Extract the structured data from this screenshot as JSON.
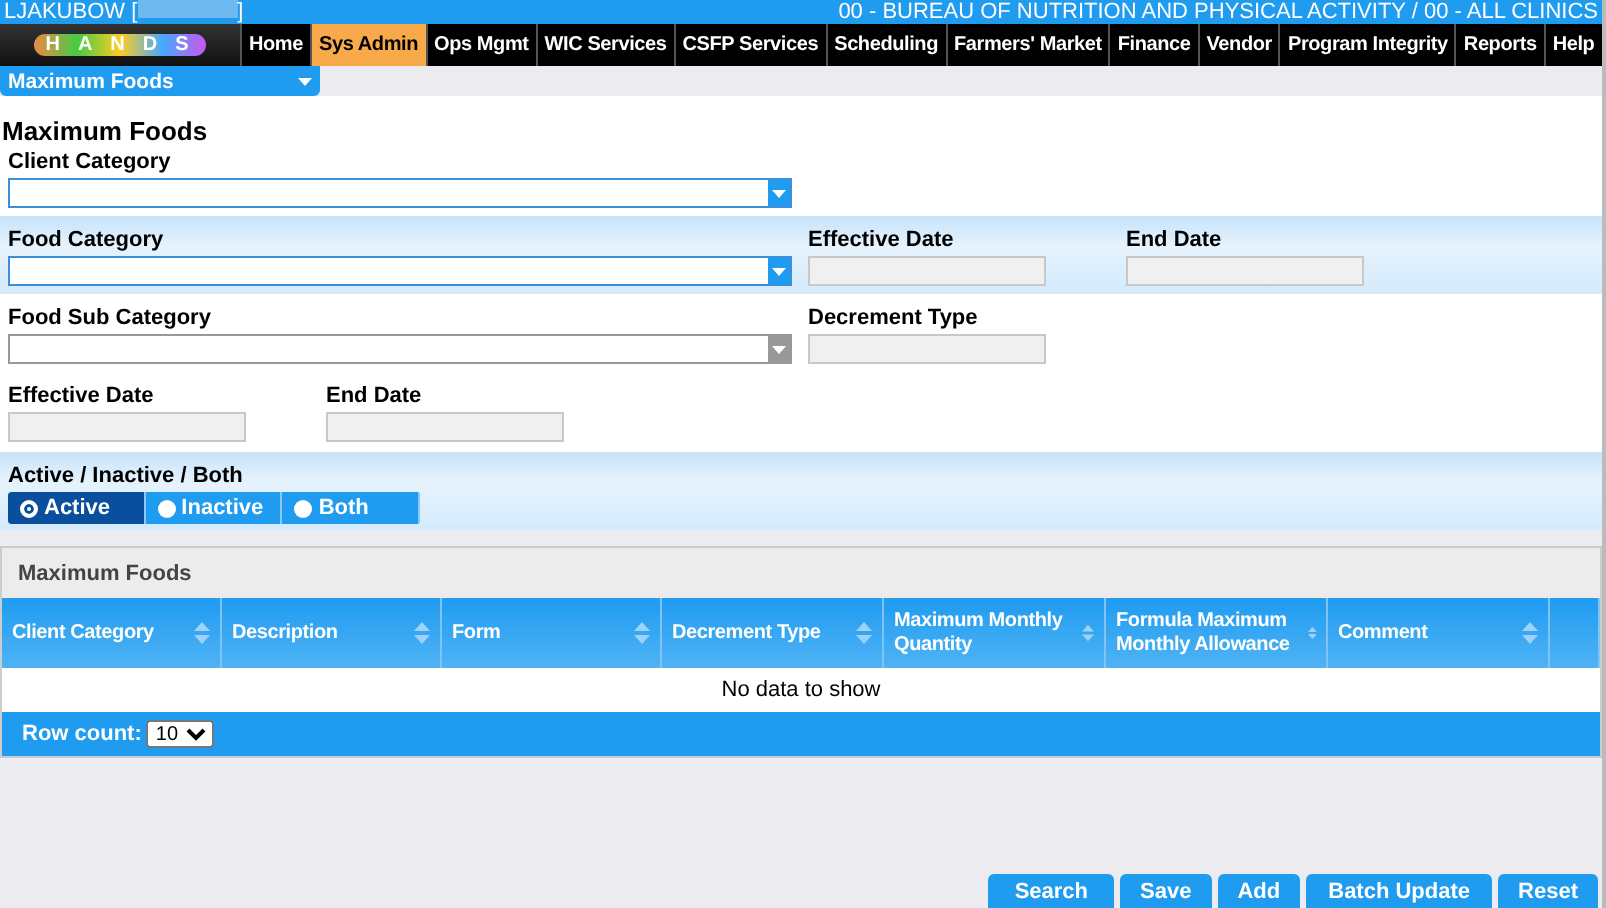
{
  "header": {
    "user": "LJAKUBOW [",
    "user_end": "]",
    "agency": "00 - BUREAU OF NUTRITION AND PHYSICAL ACTIVITY / 00 - ALL CLINICS",
    "logo_text": "HANDS"
  },
  "nav": [
    {
      "label": "Home",
      "selected": false
    },
    {
      "label": "Sys Admin",
      "selected": true
    },
    {
      "label": "Ops Mgmt",
      "selected": false
    },
    {
      "label": "WIC Services",
      "selected": false
    },
    {
      "label": "CSFP Services",
      "selected": false
    },
    {
      "label": "Scheduling",
      "selected": false
    },
    {
      "label": "Farmers' Market",
      "selected": false
    },
    {
      "label": "Finance",
      "selected": false
    },
    {
      "label": "Vendor",
      "selected": false
    },
    {
      "label": "Program Integrity",
      "selected": false
    },
    {
      "label": "Reports",
      "selected": false
    },
    {
      "label": "Help",
      "selected": false
    }
  ],
  "page_menu": "Maximum Foods",
  "title": "Maximum Foods",
  "form": {
    "client_category": {
      "label": "Client Category",
      "disabled": false
    },
    "food_category": {
      "label": "Food Category",
      "disabled": false
    },
    "food_effective_date": {
      "label": "Effective Date"
    },
    "food_end_date": {
      "label": "End Date"
    },
    "food_sub_category": {
      "label": "Food Sub Category",
      "disabled": true
    },
    "decrement_type": {
      "label": "Decrement Type"
    },
    "effective_date": {
      "label": "Effective Date"
    },
    "end_date": {
      "label": "End Date"
    },
    "status": {
      "label": "Active / Inactive / Both",
      "options": [
        {
          "label": "Active",
          "selected": true
        },
        {
          "label": "Inactive",
          "selected": false
        },
        {
          "label": "Both",
          "selected": false
        }
      ]
    }
  },
  "grid": {
    "title": "Maximum Foods",
    "columns": [
      "Client Category",
      "Description",
      "Form",
      "Decrement Type",
      "Maximum Monthly Quantity",
      "Formula Maximum Monthly Allowance",
      "Comment"
    ],
    "empty": "No data to show",
    "row_count_label": "Row count:",
    "row_count": "10"
  },
  "buttons": [
    "Search",
    "Save",
    "Add",
    "Batch Update",
    "Reset"
  ]
}
